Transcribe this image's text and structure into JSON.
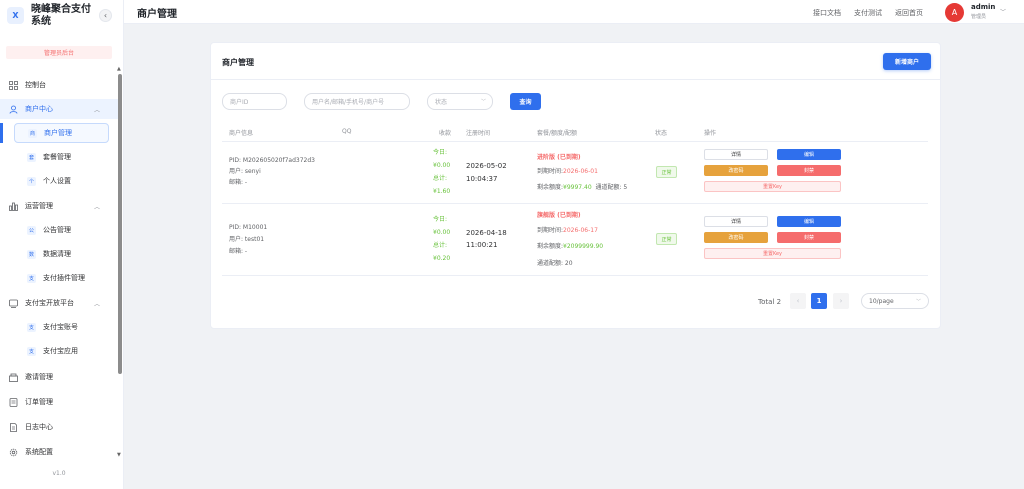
{
  "app": {
    "logo_letter": "X",
    "title": "晓峰聚合支付系统",
    "collapse_icon": "‹",
    "role_badge": "管理员后台",
    "version": "v1.0"
  },
  "sidebar": {
    "items": [
      {
        "label": "控制台",
        "icon": "dashboard-icon"
      },
      {
        "label": "商户中心",
        "icon": "user-icon",
        "expanded": true
      },
      {
        "label": "商户管理",
        "icon_char": "商",
        "active": true
      },
      {
        "label": "套餐管理",
        "icon_char": "套"
      },
      {
        "label": "个人设置",
        "icon_char": "个"
      },
      {
        "label": "运营管理",
        "icon": "chart-icon",
        "expanded": true
      },
      {
        "label": "公告管理",
        "icon_char": "公"
      },
      {
        "label": "数据清理",
        "icon_char": "数"
      },
      {
        "label": "支付插件管理",
        "icon_char": "支"
      },
      {
        "label": "支付宝开放平台",
        "icon": "app-icon",
        "expanded": true
      },
      {
        "label": "支付宝账号",
        "icon_char": "支"
      },
      {
        "label": "支付宝应用",
        "icon_char": "支"
      },
      {
        "label": "邀请管理",
        "icon": "invite-icon"
      },
      {
        "label": "订单管理",
        "icon": "order-icon"
      },
      {
        "label": "日志中心",
        "icon": "log-icon"
      },
      {
        "label": "系统配置",
        "icon": "gear-icon"
      }
    ]
  },
  "header": {
    "title": "商户管理",
    "links": [
      "接口文档",
      "支付测试",
      "返回首页"
    ],
    "avatar_letter": "A",
    "user_name": "admin",
    "user_role": "管理员"
  },
  "card": {
    "title": "商户管理",
    "add_button": "新增商户"
  },
  "filters": {
    "merchant_id_placeholder": "商户ID",
    "search_placeholder": "用户名/邮箱/手机号/商户号",
    "status_placeholder": "状态",
    "query_button": "查询"
  },
  "table": {
    "headers": [
      "商户信息",
      "QQ",
      "收款",
      "注册时间",
      "套餐/额度/配额",
      "状态",
      "操作"
    ],
    "rows": [
      {
        "pid": "PID: M202605020f7ad372d3",
        "user": "用户: senyi",
        "email": "邮箱: -",
        "qq": "",
        "today": "今日:",
        "today_amount": "¥0.00",
        "total": "总计:",
        "total_amount": "¥1.60",
        "reg_date": "2026-05-02",
        "reg_time": "10:04:37",
        "plan": "进阶版 (已到期)",
        "expire_label": "到期时间:",
        "expire_date": "2026-06-01",
        "balance_label": "剩余额度:",
        "balance": "¥9997.40",
        "quota": "通道配额: 5",
        "status": "正常"
      },
      {
        "pid": "PID: M10001",
        "user": "用户: test01",
        "email": "邮箱: -",
        "qq": "",
        "today": "今日:",
        "today_amount": "¥0.00",
        "total": "总计:",
        "total_amount": "¥0.20",
        "reg_date": "2026-04-18",
        "reg_time": "11:00:21",
        "plan": "旗舰版 (已到期)",
        "expire_label": "到期时间:",
        "expire_date": "2026-06-17",
        "balance_label": "剩余额度:",
        "balance": "¥2099999.90",
        "quota": "通道配额: 20",
        "status": "正常"
      }
    ],
    "actions": {
      "detail": "详情",
      "edit": "编辑",
      "change_password": "改密码",
      "ban": "封禁",
      "reset_key": "重置Key"
    }
  },
  "pagination": {
    "total": "Total 2",
    "current_page": "1",
    "prev_icon": "‹",
    "next_icon": "›",
    "page_size": "10/page"
  },
  "colors": {
    "primary": "#2f6fed",
    "success": "#67c23a",
    "danger": "#f56c6c",
    "warning": "#e6a23c"
  }
}
